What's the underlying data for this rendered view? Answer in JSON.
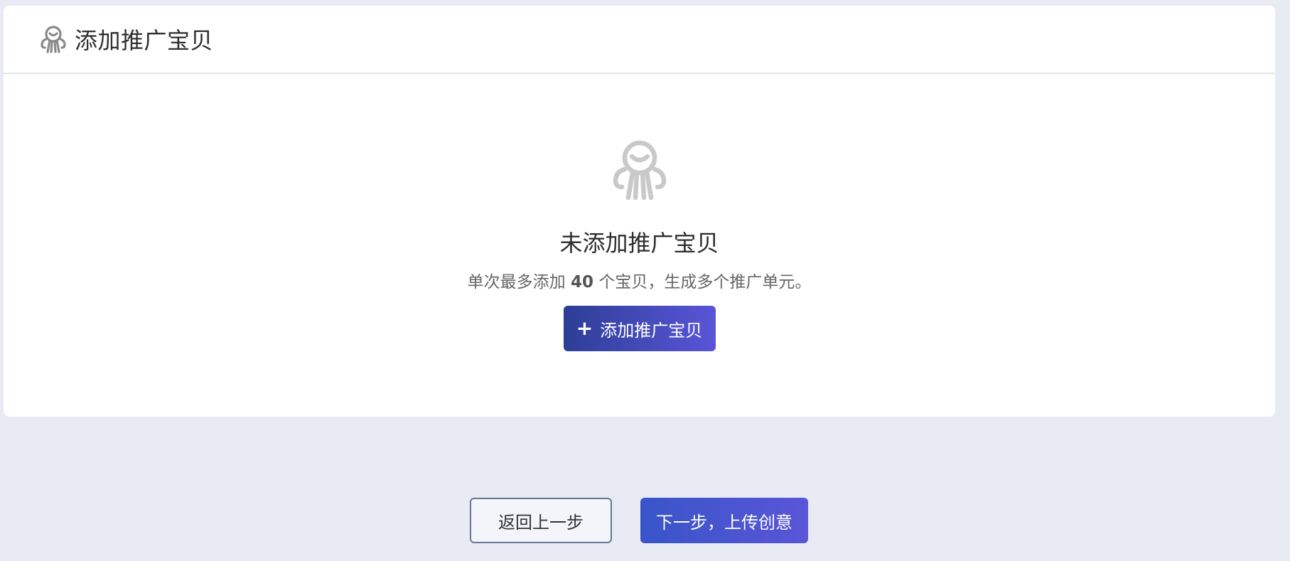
{
  "header": {
    "title": "添加推广宝贝",
    "icon": "octopus-icon"
  },
  "empty_state": {
    "icon": "octopus-icon",
    "title": "未添加推广宝贝",
    "desc_prefix": "单次最多添加",
    "desc_count": "40",
    "desc_suffix": "个宝贝，生成多个推广单元。",
    "add_button_plus": "+",
    "add_button_label": "添加推广宝贝"
  },
  "footer": {
    "back_label": "返回上一步",
    "next_label": "下一步，上传创意"
  },
  "colors": {
    "background": "#e8ebf3",
    "primary_gradient_start": "#2d3e96",
    "primary_gradient_end": "#5a55d8",
    "icon_gray": "#c8c8c8"
  }
}
